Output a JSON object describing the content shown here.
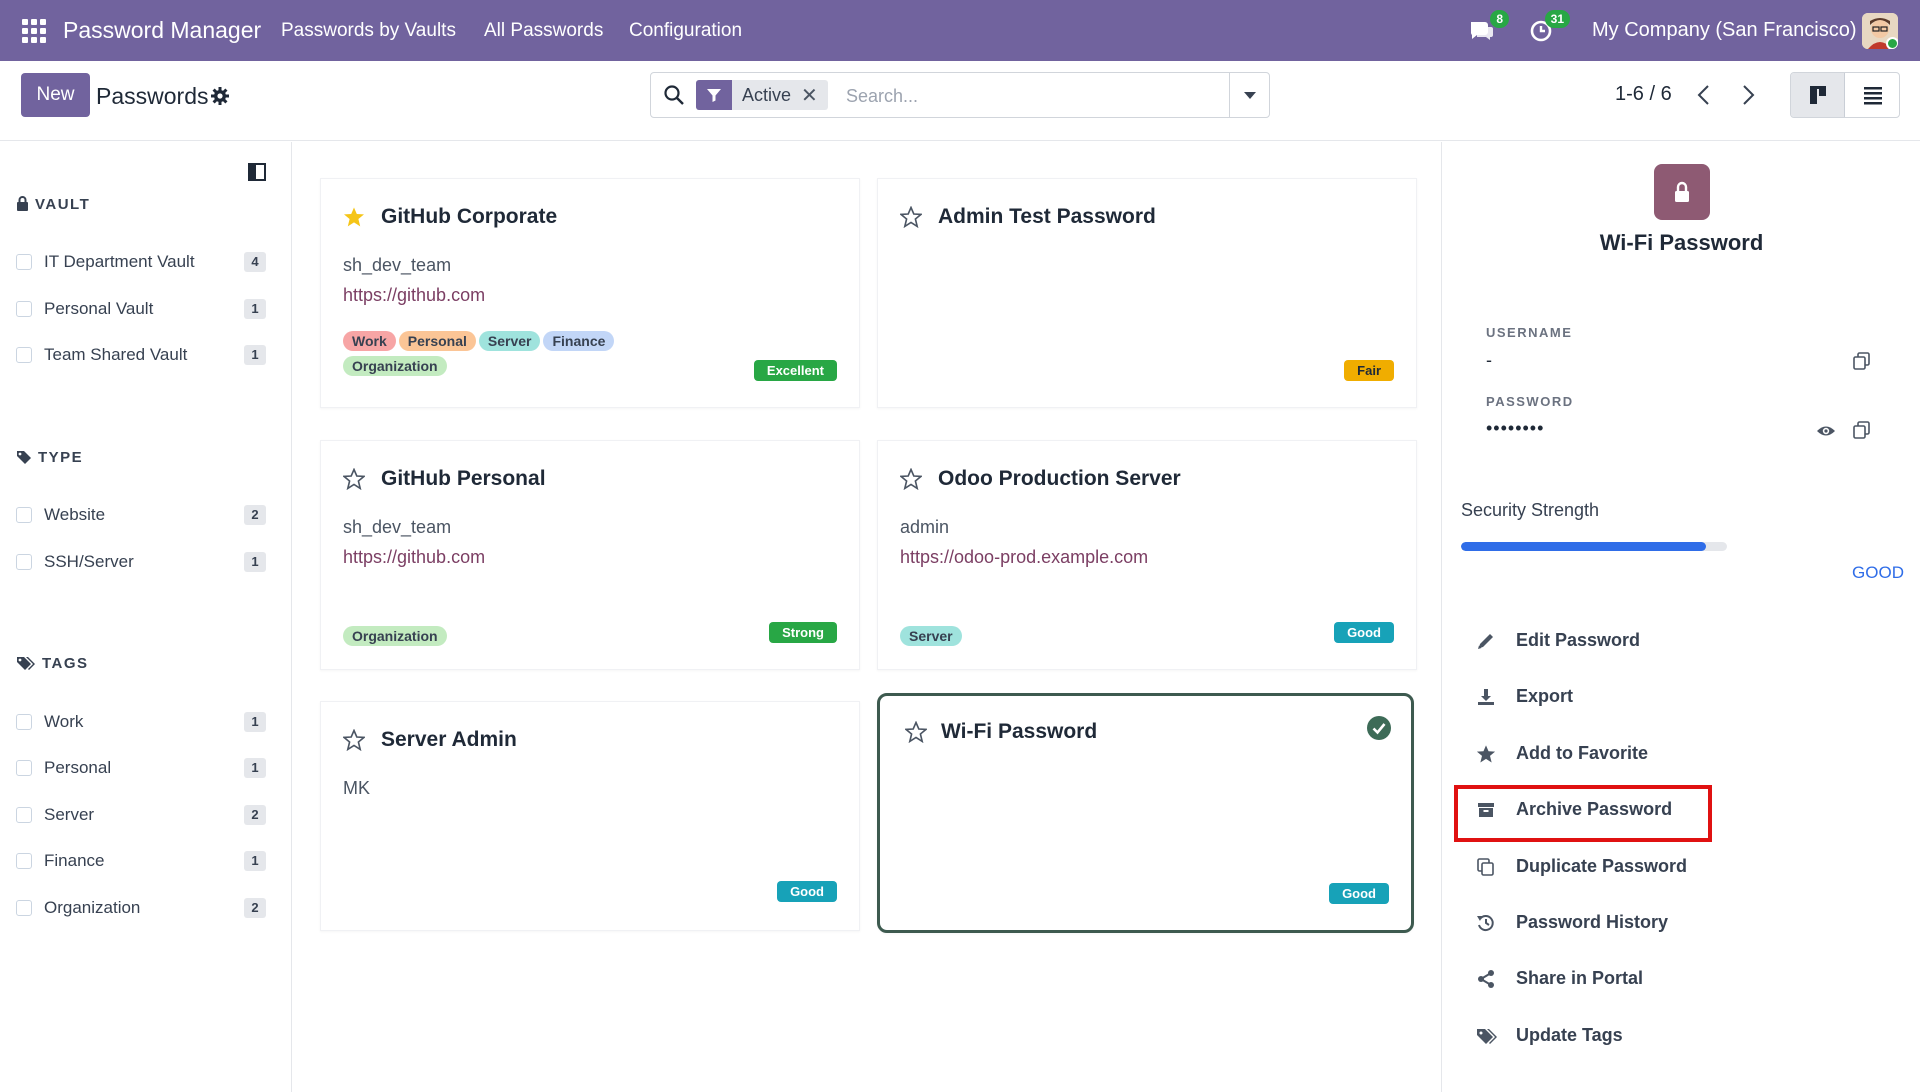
{
  "navbar": {
    "brand": "Password Manager",
    "menu": [
      "Passwords by Vaults",
      "All Passwords",
      "Configuration"
    ],
    "messages_count": "8",
    "activities_count": "31",
    "company": "My Company (San Francisco)"
  },
  "control_panel": {
    "new_label": "New",
    "title": "Passwords",
    "filter_facet": "Active",
    "search_placeholder": "Search...",
    "pager": "1-6 / 6"
  },
  "sidebar": {
    "vault_title": "VAULT",
    "vaults": [
      {
        "label": "IT Department Vault",
        "count": "4"
      },
      {
        "label": "Personal Vault",
        "count": "1"
      },
      {
        "label": "Team Shared Vault",
        "count": "1"
      }
    ],
    "type_title": "TYPE",
    "types": [
      {
        "label": "Website",
        "count": "2"
      },
      {
        "label": "SSH/Server",
        "count": "1"
      }
    ],
    "tags_title": "TAGS",
    "tags": [
      {
        "label": "Work",
        "count": "1"
      },
      {
        "label": "Personal",
        "count": "1"
      },
      {
        "label": "Server",
        "count": "2"
      },
      {
        "label": "Finance",
        "count": "1"
      },
      {
        "label": "Organization",
        "count": "2"
      }
    ]
  },
  "cards": [
    {
      "title": "GitHub Corporate",
      "username": "sh_dev_team",
      "url": "https://github.com",
      "favorite": true,
      "tags": [
        "Work",
        "Personal",
        "Server",
        "Finance",
        "Organization"
      ],
      "strength": "Excellent"
    },
    {
      "title": "Admin Test Password",
      "username": "",
      "url": "",
      "favorite": false,
      "tags": [],
      "strength": "Fair"
    },
    {
      "title": "GitHub Personal",
      "username": "sh_dev_team",
      "url": "https://github.com",
      "favorite": false,
      "tags": [
        "Organization"
      ],
      "strength": "Strong"
    },
    {
      "title": "Odoo Production Server",
      "username": "admin",
      "url": "https://odoo-prod.example.com",
      "favorite": false,
      "tags": [
        "Server"
      ],
      "strength": "Good"
    },
    {
      "title": "Server Admin",
      "username": "MK",
      "url": "",
      "favorite": false,
      "tags": [],
      "strength": "Good"
    },
    {
      "title": "Wi-Fi Password",
      "username": "",
      "url": "",
      "favorite": false,
      "tags": [],
      "strength": "Good",
      "selected": true
    }
  ],
  "colors": {
    "primary": "#71639e",
    "tag_work": "#f7a5a5",
    "tag_personal": "#fbc596",
    "tag_server": "#9fe3dd",
    "tag_finance": "#c2d6f7",
    "tag_organization": "#c3ebc0",
    "excellent": "#28a745",
    "fair": "#f0ad00",
    "strong": "#28a745",
    "good": "#17a2b8",
    "progress": "#2f6de8",
    "highlight": "#e01111"
  },
  "detail": {
    "title": "Wi-Fi Password",
    "username_label": "USERNAME",
    "username_value": "-",
    "password_label": "PASSWORD",
    "password_value": "••••••••",
    "strength_label": "Security Strength",
    "strength_value": "GOOD",
    "strength_fraction": 0.92,
    "actions": [
      "Edit Password",
      "Export",
      "Add to Favorite",
      "Archive Password",
      "Duplicate Password",
      "Password History",
      "Share in Portal",
      "Update Tags"
    ]
  }
}
